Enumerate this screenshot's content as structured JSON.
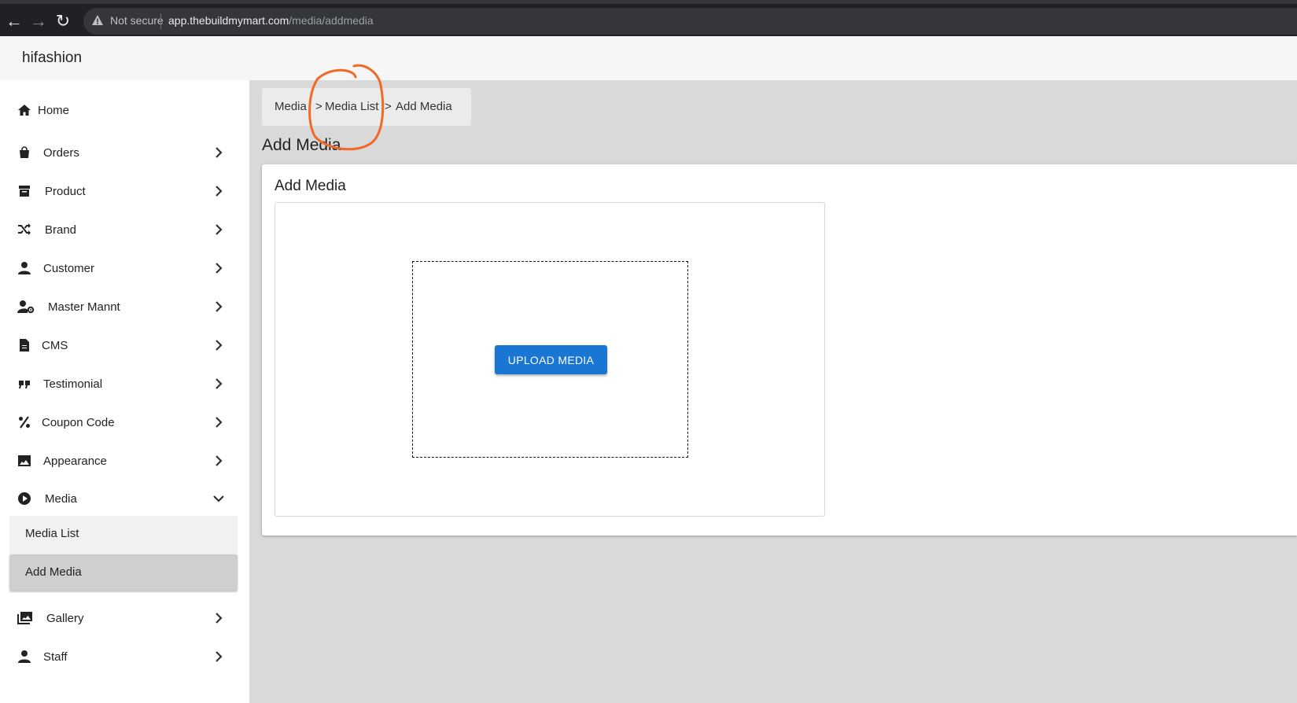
{
  "browser": {
    "security": "Not secure",
    "url_host": "app.thebuildmymart.com",
    "url_path": "/media/addmedia"
  },
  "app": {
    "brand": "hifashion"
  },
  "sidebar": {
    "items": [
      {
        "label": "Home",
        "icon": "home-icon"
      },
      {
        "label": "Orders",
        "icon": "shopping-bag-icon"
      },
      {
        "label": "Product",
        "icon": "archive-icon"
      },
      {
        "label": "Brand",
        "icon": "shuffle-icon"
      },
      {
        "label": "Customer",
        "icon": "user-icon"
      },
      {
        "label": "Master Mannt",
        "icon": "user-gear-icon"
      },
      {
        "label": "CMS",
        "icon": "document-icon"
      },
      {
        "label": "Testimonial",
        "icon": "quote-icon"
      },
      {
        "label": "Coupon Code",
        "icon": "percent-icon"
      },
      {
        "label": "Appearance",
        "icon": "image-icon"
      },
      {
        "label": "Media",
        "icon": "play-circle-icon"
      },
      {
        "label": "Gallery",
        "icon": "images-icon"
      },
      {
        "label": "Staff",
        "icon": "user-icon"
      }
    ],
    "media_sub": [
      {
        "label": "Media List"
      },
      {
        "label": "Add Media"
      }
    ]
  },
  "breadcrumb": {
    "items": [
      "Media",
      "Media List",
      "Add Media"
    ],
    "separator": ">"
  },
  "main": {
    "page_title": "Add Media",
    "card_title": "Add Media",
    "upload_button": "UPLOAD MEDIA"
  },
  "colors": {
    "primary": "#1976d2",
    "annotation": "#f06a25"
  }
}
